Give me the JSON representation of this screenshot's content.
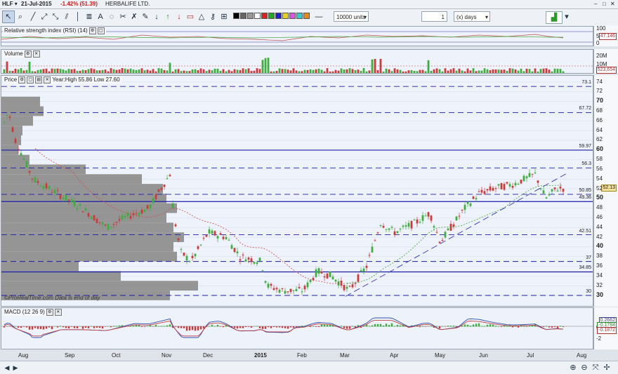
{
  "titlebar": {
    "symbol": "HLF",
    "date": "21-Jul-2015",
    "change": "-1.42% (51.39)",
    "name": "HERBALIFE LTD."
  },
  "toolbar": {
    "units_value": "10000 units",
    "interval_value": "1",
    "interval_unit": "(x) days"
  },
  "rsi_panel": {
    "title": "Relative strength index (RSI) (14)",
    "ticks": [
      "100",
      "50",
      "0"
    ],
    "value_tag": "47.146"
  },
  "volume_panel": {
    "title": "Volume",
    "ticks": [
      "20M",
      "10M"
    ],
    "value_tag": "523,654"
  },
  "price_panel": {
    "title": "Price",
    "yearline": "Year:High 55.86 Low 27.60",
    "credit": "ProRealTime.com  Data is end of day",
    "ticks": [
      "74",
      "72",
      "70",
      "68",
      "66",
      "64",
      "62",
      "60",
      "58",
      "56",
      "54",
      "52",
      "50",
      "48",
      "46",
      "44",
      "42",
      "40",
      "38",
      "36",
      "34",
      "32",
      "30"
    ],
    "value_tag": "52.13",
    "levels": [
      {
        "label": "73.1",
        "value": 73.1,
        "style": "dash"
      },
      {
        "label": "67.72",
        "value": 67.72,
        "style": "dash"
      },
      {
        "label": "59.97",
        "value": 59.97,
        "style": "solid"
      },
      {
        "label": "56.3",
        "value": 56.3,
        "style": "dash"
      },
      {
        "label": "50.85",
        "value": 50.85,
        "style": "dash"
      },
      {
        "label": "49.36",
        "value": 49.36,
        "style": "solid"
      },
      {
        "label": "42.51",
        "value": 42.51,
        "style": "dash"
      },
      {
        "label": "37",
        "value": 37,
        "style": "dash"
      },
      {
        "label": "34.85",
        "value": 34.85,
        "style": "solid"
      },
      {
        "label": "30",
        "value": 30,
        "style": "dash"
      }
    ]
  },
  "macd_panel": {
    "title": "MACD (12 26 9)",
    "ticks": [
      "0",
      "-2"
    ],
    "value_tags": [
      "0.2662",
      "-0.1784",
      "-0.1872"
    ]
  },
  "months": [
    {
      "label": "Aug",
      "bold": false
    },
    {
      "label": "Sep",
      "bold": false
    },
    {
      "label": "Oct",
      "bold": false
    },
    {
      "label": "Nov",
      "bold": false
    },
    {
      "label": "Dec",
      "bold": false
    },
    {
      "label": "2015",
      "bold": true
    },
    {
      "label": "Feb",
      "bold": false
    },
    {
      "label": "Mar",
      "bold": false
    },
    {
      "label": "Apr",
      "bold": false
    },
    {
      "label": "May",
      "bold": false
    },
    {
      "label": "Jun",
      "bold": false
    },
    {
      "label": "Jul",
      "bold": false
    },
    {
      "label": "Aug",
      "bold": false
    }
  ],
  "colors": {
    "up": "#3fae3f",
    "down": "#cc3b3b",
    "support": "#1c1ca8",
    "volume_profile": "#8f8f8f",
    "panel_bg": "#eef2fb"
  }
}
